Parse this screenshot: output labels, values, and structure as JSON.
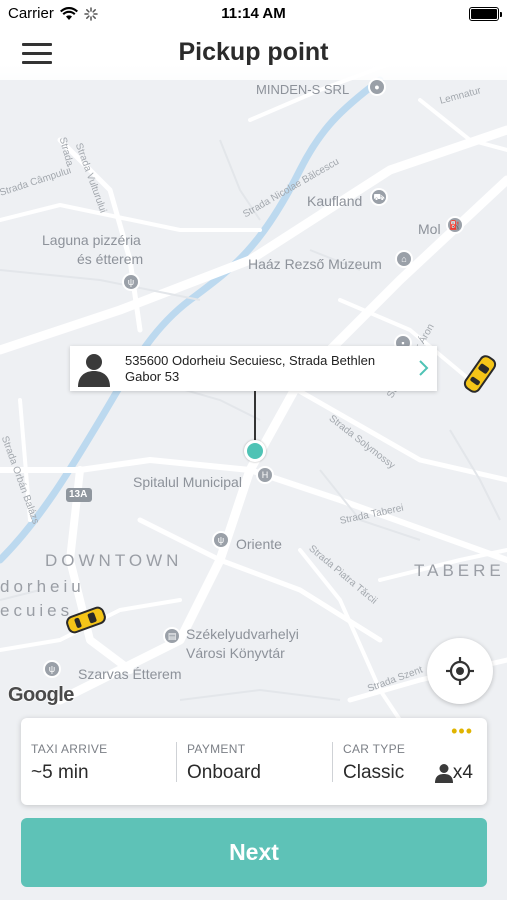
{
  "status_bar": {
    "carrier": "Carrier",
    "time": "11:14 AM"
  },
  "header": {
    "title": "Pickup point",
    "menu_icon": "hamburger-menu-icon"
  },
  "map": {
    "labels": {
      "minden": "MINDEN-S SRL",
      "kaufland": "Kaufland",
      "mol": "Mol",
      "laguna_1": "Laguna pizzéria",
      "laguna_2": "és étterem",
      "haaz": "Haáz Rezső Múzeum",
      "spitalul": "Spitalul Municipal",
      "oriente": "Oriente",
      "downtown": "DOWNTOWN",
      "taberei": "TABERE",
      "odorheiu_1": "dorheiu",
      "odorheiu_2": "ecuies",
      "konyvtar_1": "Székelyudvarhelyi",
      "konyvtar_2": "Városi Könyvtár",
      "szarvas": "Szarvas Étterem",
      "route_13a": "13A"
    },
    "streets": {
      "balcescu": "Strada Nicolae Bălcescu",
      "vulturului": "Strada Vulturului",
      "campului": "Strada Câmpului",
      "stradita": "Strada",
      "gabor_aron": "Strada Gábor Áron",
      "solymossy": "Strada Solymossy",
      "taberei": "Strada Taberei",
      "piatra": "Strada Piatra Tărcii",
      "orban": "Strada Orbán Balázs",
      "szent": "Strada Szent",
      "lemnaturi": "Lemnatur"
    },
    "callout_address": "535600 Odorheiu Secuiesc, Strada Bethlen Gabor 53",
    "google_logo": "Google",
    "colors": {
      "map_bg": "#eef0f3",
      "river": "#b8d7ee",
      "pin": "#4fc3b5",
      "taxi": "#f5c518"
    }
  },
  "trip_info": {
    "taxi_arrive": {
      "label": "TAXI ARRIVE",
      "value": "~5 min"
    },
    "payment": {
      "label": "PAYMENT",
      "value": "Onboard"
    },
    "car_type": {
      "label": "CAR TYPE",
      "value": "Classic"
    },
    "passengers": "x4",
    "more_icon": "more-dots-icon"
  },
  "actions": {
    "next_label": "Next",
    "accent": "#5ec2b7"
  }
}
